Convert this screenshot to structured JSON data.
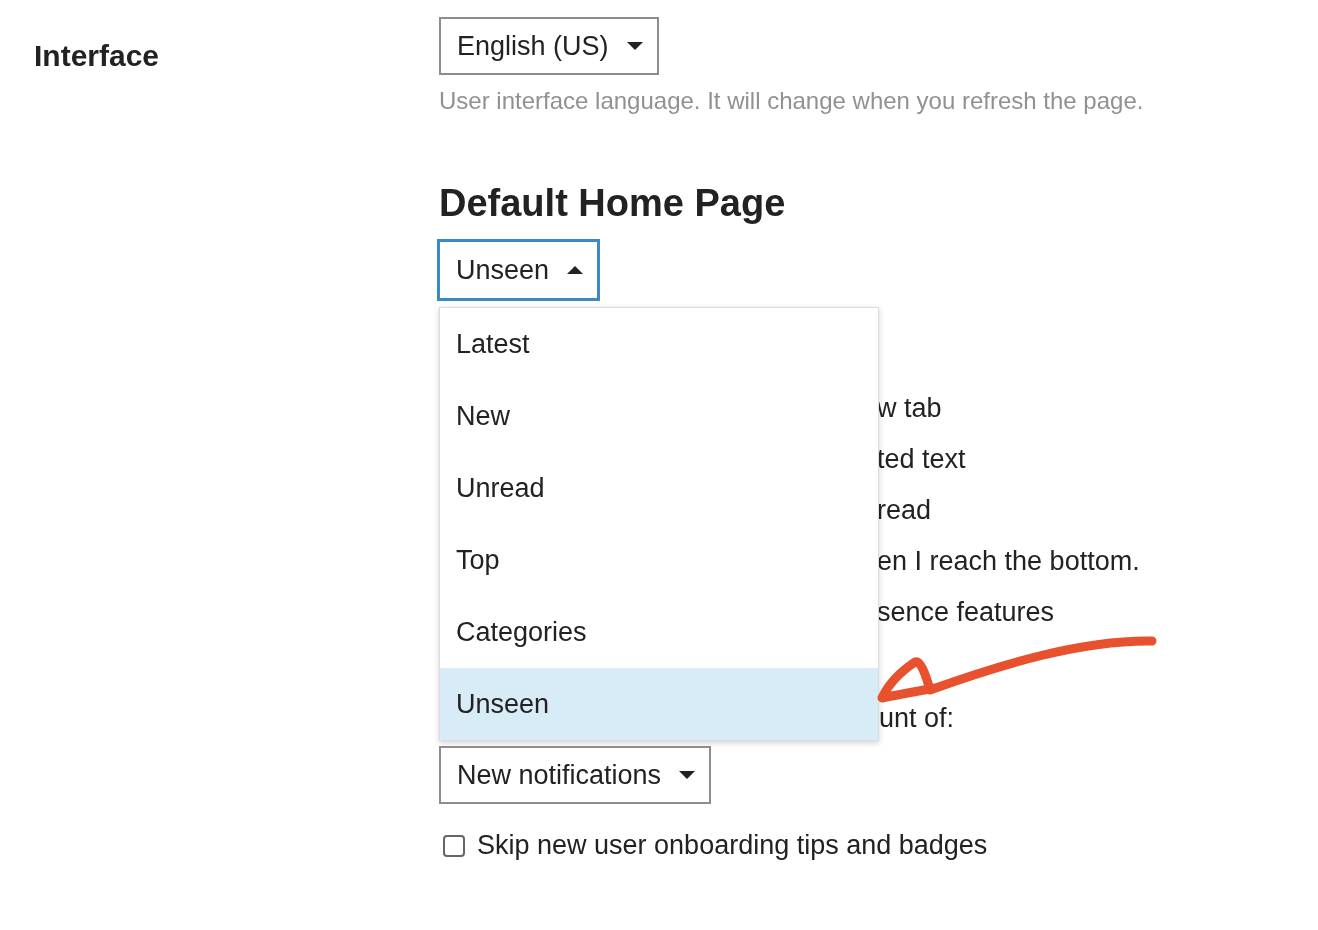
{
  "interface": {
    "label": "Interface",
    "language_select": {
      "value": "English (US)",
      "expanded": false
    },
    "language_help": "User interface language. It will change when you refresh the page."
  },
  "default_home_page": {
    "heading": "Default Home Page",
    "select": {
      "value": "Unseen",
      "expanded": true
    },
    "options": [
      {
        "label": "Latest",
        "selected": false
      },
      {
        "label": "New",
        "selected": false
      },
      {
        "label": "Unread",
        "selected": false
      },
      {
        "label": "Top",
        "selected": false
      },
      {
        "label": "Categories",
        "selected": false
      },
      {
        "label": "Unseen",
        "selected": true
      }
    ]
  },
  "obscured_lines": [
    "w tab",
    "ted text",
    "read",
    "en I reach the bottom.",
    "sence features"
  ],
  "count_label": "unt of:",
  "notifications_select": {
    "value": "New notifications",
    "expanded": false
  },
  "skip_onboarding": {
    "label": "Skip new user onboarding tips and badges",
    "checked": false
  }
}
